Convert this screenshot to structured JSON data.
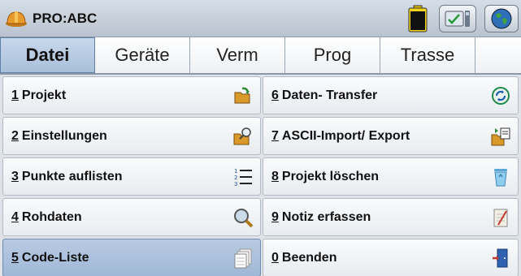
{
  "app": {
    "title": "PRO:ABC"
  },
  "tabs": [
    {
      "label": "Datei",
      "active": true
    },
    {
      "label": "Geräte"
    },
    {
      "label": "Verm"
    },
    {
      "label": "Prog"
    },
    {
      "label": "Trasse"
    }
  ],
  "menu": {
    "left": [
      {
        "num": "1",
        "label": "Projekt",
        "icon": "folder-open-icon"
      },
      {
        "num": "2",
        "label": "Einstellungen",
        "icon": "folder-search-icon"
      },
      {
        "num": "3",
        "label": "Punkte auflisten",
        "icon": "numbered-list-icon"
      },
      {
        "num": "4",
        "label": "Rohdaten",
        "icon": "magnifier-icon"
      },
      {
        "num": "5",
        "label": "Code-Liste",
        "icon": "pages-icon",
        "selected": true
      }
    ],
    "right": [
      {
        "num": "6",
        "label": "Daten- Transfer",
        "icon": "sync-icon"
      },
      {
        "num": "7",
        "label": "ASCII-Import/ Export",
        "icon": "import-export-icon"
      },
      {
        "num": "8",
        "label": "Projekt löschen",
        "icon": "recycle-bin-icon"
      },
      {
        "num": "9",
        "label": "Notiz erfassen",
        "icon": "notepad-icon"
      },
      {
        "num": "0",
        "label": "Beenden",
        "icon": "exit-door-icon"
      }
    ]
  },
  "colors": {
    "selected": "#a9bfdb",
    "accent": "#2e7d32"
  }
}
